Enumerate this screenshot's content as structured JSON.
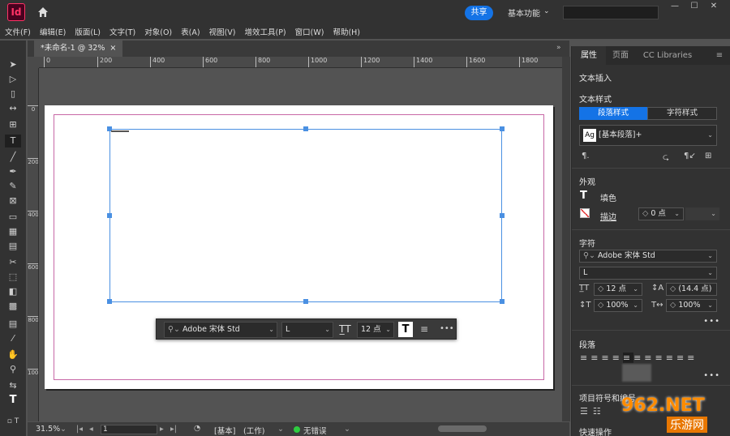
{
  "app": {
    "logo": "Id",
    "share": "共享",
    "workspace": "基本功能"
  },
  "menu": [
    "文件(F)",
    "编辑(E)",
    "版面(L)",
    "文字(T)",
    "对象(O)",
    "表(A)",
    "视图(V)",
    "增效工具(P)",
    "窗口(W)",
    "帮助(H)"
  ],
  "doc_tab": {
    "title": "*未命名-1 @ 32%",
    "close": "×"
  },
  "ruler_h": [
    "0",
    "200",
    "400",
    "600",
    "800",
    "1000",
    "1200",
    "1400",
    "1600",
    "1800"
  ],
  "ruler_v": [
    "0",
    "200",
    "400",
    "600",
    "800",
    "1000"
  ],
  "floating_control": {
    "font": "Adobe 宋体 Std",
    "style": "L",
    "size": "12 点",
    "more": "•••"
  },
  "status": {
    "zoom": "31.5%",
    "page": "1",
    "master": "[基本]",
    "mode": "(工作)",
    "errors": "无错误"
  },
  "panel": {
    "tabs": [
      "属性",
      "页面",
      "CC Libraries"
    ],
    "text_insert": "文本插入",
    "text_style": "文本样式",
    "para_style_tab": "段落样式",
    "char_style_tab": "字符样式",
    "para_style_value": "[基本段落]+",
    "para_style_icon": "Ag",
    "appearance": "外观",
    "fill": "填色",
    "stroke": "描边",
    "stroke_value": "0 点",
    "character": "字符",
    "font": "Adobe 宋体 Std",
    "font_style": "L",
    "size": "12 点",
    "leading": "(14.4 点)",
    "vscale": "100%",
    "hscale": "100%",
    "paragraph": "段落",
    "bullets": "项目符号和编号",
    "quick_actions": "快速操作",
    "more": "•••"
  },
  "watermark": "962.NET 乐游网"
}
